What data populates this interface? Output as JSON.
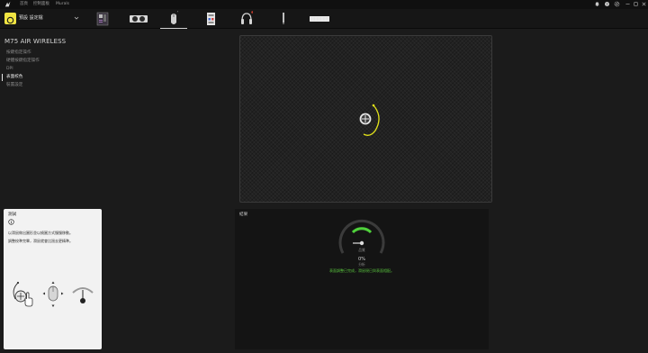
{
  "titlebar": {
    "menu": [
      "首頁",
      "控制面板",
      "Murals"
    ],
    "right_icons": [
      "bell-icon",
      "help-icon",
      "settings-icon"
    ],
    "window_controls": [
      "minimize-icon",
      "maximize-icon",
      "close-icon"
    ]
  },
  "profile": {
    "name": "預設 設定檔",
    "icon_color": "#f0e442"
  },
  "devices": [
    {
      "name": "motherboard",
      "active": false
    },
    {
      "name": "graphics-card",
      "active": false
    },
    {
      "name": "mouse",
      "active": true
    },
    {
      "name": "memory",
      "active": false
    },
    {
      "name": "headset",
      "active": false
    },
    {
      "name": "usb-stick",
      "active": false
    },
    {
      "name": "keyboard",
      "active": false
    }
  ],
  "device_title": "M75 AIR WIRELESS",
  "nav": [
    {
      "label": "按鍵指定操作",
      "active": false
    },
    {
      "label": "硬體按鍵指定操作",
      "active": false
    },
    {
      "label": "DPI",
      "active": false
    },
    {
      "label": "表面校色",
      "active": true
    },
    {
      "label": "裝置設定",
      "active": false
    }
  ],
  "result": {
    "title": "結果",
    "gauge_label": "品質",
    "gauge_value": "0%",
    "gauge_caption": "分析",
    "gauge_fraction": 0.0,
    "success_text": "表面調整已完成，滑鼠現已與表面相配。",
    "accent": "#58c23d"
  },
  "help": {
    "title": "測試",
    "line1": "以滑鼠做出圓形並以繞圓方式慢慢移動。",
    "line2": "調整校準完畢，滑鼠就會比過去更精準。"
  },
  "accent_yellow": "#e3e31a"
}
